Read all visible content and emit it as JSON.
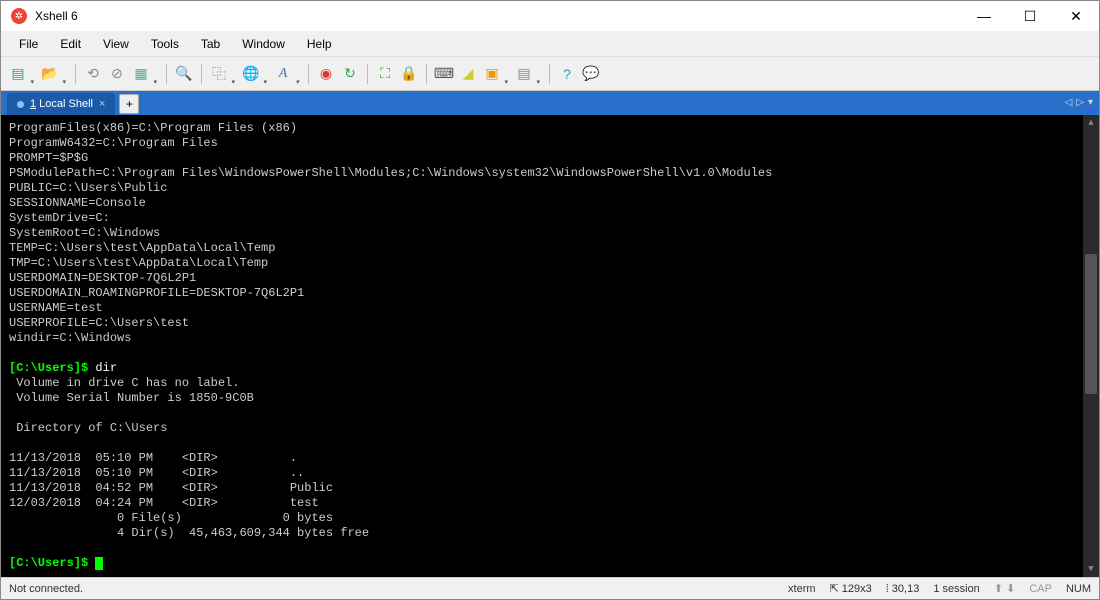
{
  "window": {
    "title": "Xshell 6"
  },
  "menu": {
    "file": "File",
    "edit": "Edit",
    "view": "View",
    "tools": "Tools",
    "tab": "Tab",
    "window": "Window",
    "help": "Help"
  },
  "tabs": {
    "active_label": "1 Local Shell"
  },
  "terminal": {
    "lines": [
      "ProgramFiles(x86)=C:\\Program Files (x86)",
      "ProgramW6432=C:\\Program Files",
      "PROMPT=$P$G",
      "PSModulePath=C:\\Program Files\\WindowsPowerShell\\Modules;C:\\Windows\\system32\\WindowsPowerShell\\v1.0\\Modules",
      "PUBLIC=C:\\Users\\Public",
      "SESSIONNAME=Console",
      "SystemDrive=C:",
      "SystemRoot=C:\\Windows",
      "TEMP=C:\\Users\\test\\AppData\\Local\\Temp",
      "TMP=C:\\Users\\test\\AppData\\Local\\Temp",
      "USERDOMAIN=DESKTOP-7Q6L2P1",
      "USERDOMAIN_ROAMINGPROFILE=DESKTOP-7Q6L2P1",
      "USERNAME=test",
      "USERPROFILE=C:\\Users\\test",
      "windir=C:\\Windows"
    ],
    "prompt1": "[C:\\Users]$ ",
    "cmd1": "dir",
    "dir_output": [
      " Volume in drive C has no label.",
      " Volume Serial Number is 1850-9C0B",
      "",
      " Directory of C:\\Users",
      "",
      "11/13/2018  05:10 PM    <DIR>          .",
      "11/13/2018  05:10 PM    <DIR>          ..",
      "11/13/2018  04:52 PM    <DIR>          Public",
      "12/03/2018  04:24 PM    <DIR>          test",
      "               0 File(s)              0 bytes",
      "               4 Dir(s)  45,463,609,344 bytes free"
    ],
    "prompt2": "[C:\\Users]$ "
  },
  "status": {
    "connection": "Not connected.",
    "term_type": "xterm",
    "size": "129x3",
    "cursor": "30,13",
    "sessions": "1 session",
    "cap": "CAP",
    "num": "NUM"
  }
}
